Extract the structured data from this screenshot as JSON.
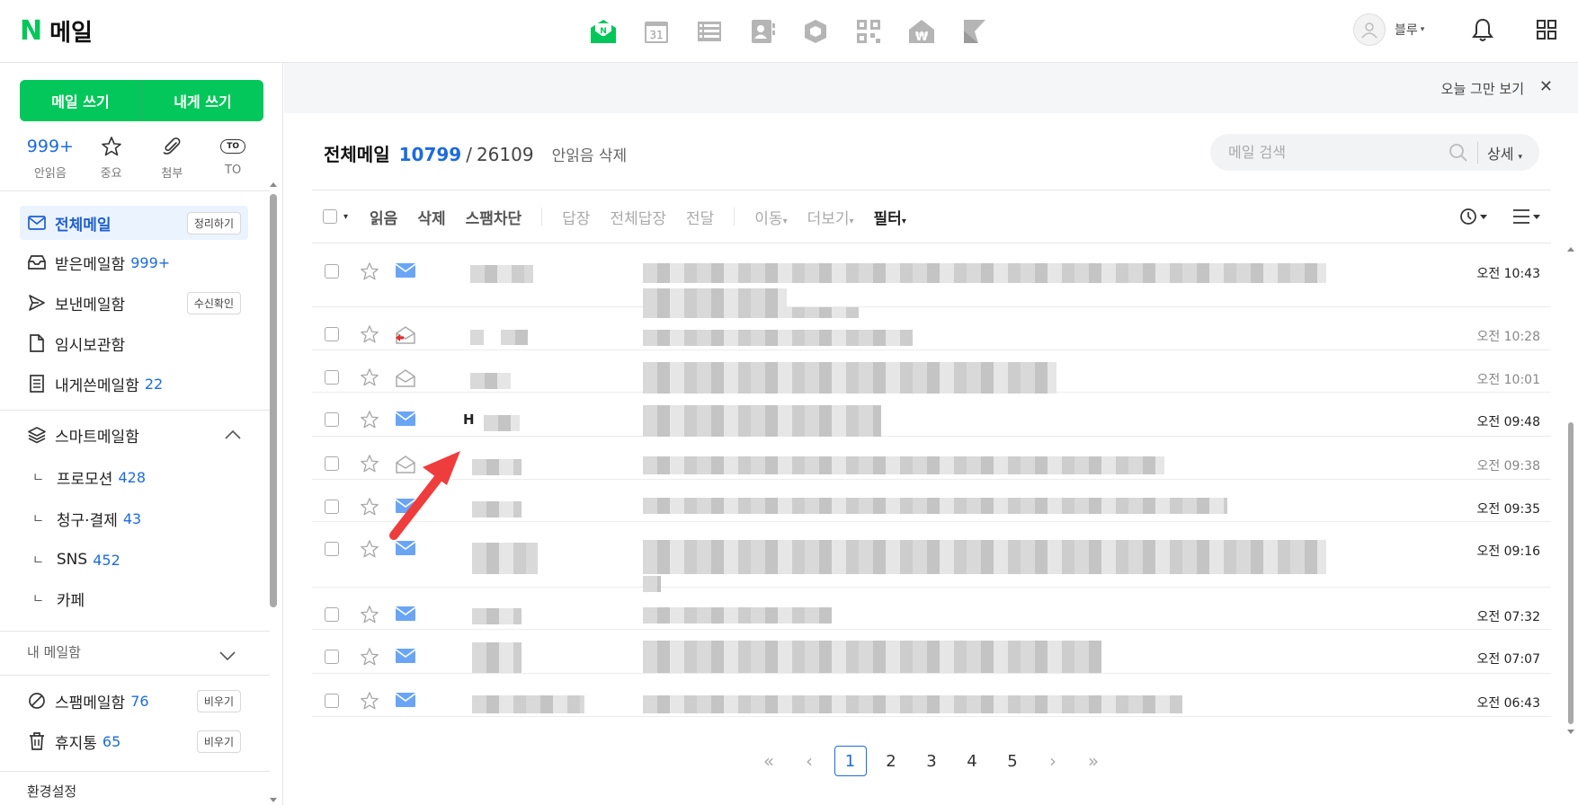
{
  "app": {
    "logo_letter": "N",
    "title": "메일"
  },
  "header": {
    "apps": [
      "mail-icon",
      "calendar-icon",
      "list-icon",
      "contacts-icon",
      "box-icon",
      "qr-icon",
      "pay-icon",
      "bookmark-icon"
    ],
    "calendar_day": "31",
    "profile_name": "블루",
    "caret": "▾"
  },
  "sidebar": {
    "write_label": "메일 쓰기",
    "self_write_label": "내게 쓰기",
    "quick": {
      "unread_count": "999+",
      "unread_label": "안읽음",
      "important_label": "중요",
      "attach_label": "첨부",
      "to_badge": "TO",
      "to_label": "TO"
    },
    "folders": [
      {
        "label": "전체메일",
        "count": "",
        "chip": "정리하기"
      },
      {
        "label": "받은메일함",
        "count": "999+",
        "chip": ""
      },
      {
        "label": "보낸메일함",
        "count": "",
        "chip": "수신확인"
      },
      {
        "label": "임시보관함",
        "count": "",
        "chip": ""
      },
      {
        "label": "내게쓴메일함",
        "count": "22",
        "chip": ""
      }
    ],
    "smart": {
      "label": "스마트메일함",
      "items": [
        {
          "label": "프로모션",
          "count": "428"
        },
        {
          "label": "청구·결제",
          "count": "43"
        },
        {
          "label": "SNS",
          "count": "452"
        },
        {
          "label": "카페",
          "count": ""
        }
      ]
    },
    "sub_mark": "ㄴ",
    "my_mailbox": "내 메일함",
    "spam": {
      "label": "스팸메일함",
      "count": "76",
      "chip": "비우기"
    },
    "trash": {
      "label": "휴지통",
      "count": "65",
      "chip": "비우기"
    },
    "settings": "환경설정"
  },
  "notice": {
    "text": "오늘 그만 보기",
    "close": "✕"
  },
  "list": {
    "title": "전체메일",
    "unread": "10799",
    "sep": "/",
    "total": "26109",
    "delete_unread": "안읽음 삭제"
  },
  "search": {
    "placeholder": "메일 검색",
    "detail": "상세"
  },
  "toolbar": {
    "read": "읽음",
    "delete": "삭제",
    "spam": "스팸차단",
    "reply": "답장",
    "reply_all": "전체답장",
    "forward": "전달",
    "move": "이동",
    "more": "더보기",
    "filter": "필터",
    "dropdown": "▾"
  },
  "mails": [
    {
      "sender": "",
      "time": "오전 10:43",
      "read": false,
      "icon": "envelope-closed"
    },
    {
      "sender": "",
      "time": "오전 10:28",
      "read": true,
      "icon": "envelope-replied"
    },
    {
      "sender": "",
      "time": "오전 10:01",
      "read": true,
      "icon": "envelope-open"
    },
    {
      "sender": "H",
      "time": "오전 09:48",
      "read": false,
      "icon": "envelope-closed"
    },
    {
      "sender": "",
      "time": "오전 09:38",
      "read": true,
      "icon": "envelope-open"
    },
    {
      "sender": "",
      "time": "오전 09:35",
      "read": false,
      "icon": "envelope-closed"
    },
    {
      "sender": "",
      "time": "오전 09:16",
      "read": false,
      "icon": "envelope-closed"
    },
    {
      "sender": "",
      "time": "오전 07:32",
      "read": false,
      "icon": "envelope-closed"
    },
    {
      "sender": "",
      "time": "오전 07:07",
      "read": false,
      "icon": "envelope-closed"
    },
    {
      "sender": "",
      "time": "오전 06:43",
      "read": false,
      "icon": "envelope-closed"
    }
  ],
  "pagination": {
    "first": "«",
    "prev": "‹",
    "pages": [
      "1",
      "2",
      "3",
      "4",
      "5"
    ],
    "current": "1",
    "next": "›",
    "last": "»"
  },
  "colors": {
    "brand": "#03c75a",
    "link": "#1d6bde",
    "annotation_arrow": "#ef3d3d"
  }
}
